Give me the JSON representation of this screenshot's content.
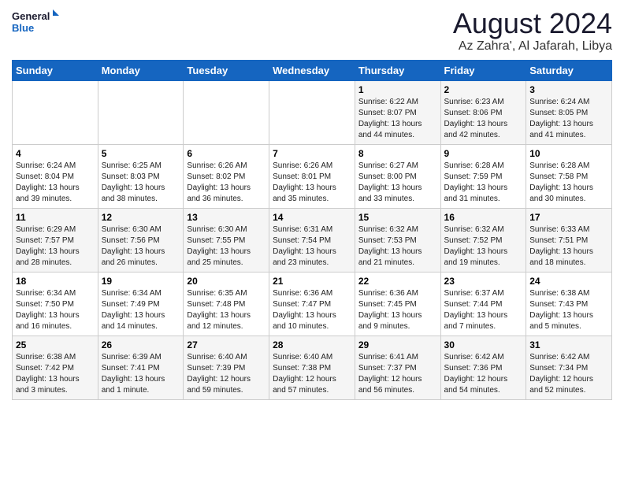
{
  "logo": {
    "line1": "General",
    "line2": "Blue"
  },
  "title": "August 2024",
  "subtitle": "Az Zahra', Al Jafarah, Libya",
  "days_of_week": [
    "Sunday",
    "Monday",
    "Tuesday",
    "Wednesday",
    "Thursday",
    "Friday",
    "Saturday"
  ],
  "weeks": [
    [
      {
        "day": "",
        "info": ""
      },
      {
        "day": "",
        "info": ""
      },
      {
        "day": "",
        "info": ""
      },
      {
        "day": "",
        "info": ""
      },
      {
        "day": "1",
        "info": "Sunrise: 6:22 AM\nSunset: 8:07 PM\nDaylight: 13 hours\nand 44 minutes."
      },
      {
        "day": "2",
        "info": "Sunrise: 6:23 AM\nSunset: 8:06 PM\nDaylight: 13 hours\nand 42 minutes."
      },
      {
        "day": "3",
        "info": "Sunrise: 6:24 AM\nSunset: 8:05 PM\nDaylight: 13 hours\nand 41 minutes."
      }
    ],
    [
      {
        "day": "4",
        "info": "Sunrise: 6:24 AM\nSunset: 8:04 PM\nDaylight: 13 hours\nand 39 minutes."
      },
      {
        "day": "5",
        "info": "Sunrise: 6:25 AM\nSunset: 8:03 PM\nDaylight: 13 hours\nand 38 minutes."
      },
      {
        "day": "6",
        "info": "Sunrise: 6:26 AM\nSunset: 8:02 PM\nDaylight: 13 hours\nand 36 minutes."
      },
      {
        "day": "7",
        "info": "Sunrise: 6:26 AM\nSunset: 8:01 PM\nDaylight: 13 hours\nand 35 minutes."
      },
      {
        "day": "8",
        "info": "Sunrise: 6:27 AM\nSunset: 8:00 PM\nDaylight: 13 hours\nand 33 minutes."
      },
      {
        "day": "9",
        "info": "Sunrise: 6:28 AM\nSunset: 7:59 PM\nDaylight: 13 hours\nand 31 minutes."
      },
      {
        "day": "10",
        "info": "Sunrise: 6:28 AM\nSunset: 7:58 PM\nDaylight: 13 hours\nand 30 minutes."
      }
    ],
    [
      {
        "day": "11",
        "info": "Sunrise: 6:29 AM\nSunset: 7:57 PM\nDaylight: 13 hours\nand 28 minutes."
      },
      {
        "day": "12",
        "info": "Sunrise: 6:30 AM\nSunset: 7:56 PM\nDaylight: 13 hours\nand 26 minutes."
      },
      {
        "day": "13",
        "info": "Sunrise: 6:30 AM\nSunset: 7:55 PM\nDaylight: 13 hours\nand 25 minutes."
      },
      {
        "day": "14",
        "info": "Sunrise: 6:31 AM\nSunset: 7:54 PM\nDaylight: 13 hours\nand 23 minutes."
      },
      {
        "day": "15",
        "info": "Sunrise: 6:32 AM\nSunset: 7:53 PM\nDaylight: 13 hours\nand 21 minutes."
      },
      {
        "day": "16",
        "info": "Sunrise: 6:32 AM\nSunset: 7:52 PM\nDaylight: 13 hours\nand 19 minutes."
      },
      {
        "day": "17",
        "info": "Sunrise: 6:33 AM\nSunset: 7:51 PM\nDaylight: 13 hours\nand 18 minutes."
      }
    ],
    [
      {
        "day": "18",
        "info": "Sunrise: 6:34 AM\nSunset: 7:50 PM\nDaylight: 13 hours\nand 16 minutes."
      },
      {
        "day": "19",
        "info": "Sunrise: 6:34 AM\nSunset: 7:49 PM\nDaylight: 13 hours\nand 14 minutes."
      },
      {
        "day": "20",
        "info": "Sunrise: 6:35 AM\nSunset: 7:48 PM\nDaylight: 13 hours\nand 12 minutes."
      },
      {
        "day": "21",
        "info": "Sunrise: 6:36 AM\nSunset: 7:47 PM\nDaylight: 13 hours\nand 10 minutes."
      },
      {
        "day": "22",
        "info": "Sunrise: 6:36 AM\nSunset: 7:45 PM\nDaylight: 13 hours\nand 9 minutes."
      },
      {
        "day": "23",
        "info": "Sunrise: 6:37 AM\nSunset: 7:44 PM\nDaylight: 13 hours\nand 7 minutes."
      },
      {
        "day": "24",
        "info": "Sunrise: 6:38 AM\nSunset: 7:43 PM\nDaylight: 13 hours\nand 5 minutes."
      }
    ],
    [
      {
        "day": "25",
        "info": "Sunrise: 6:38 AM\nSunset: 7:42 PM\nDaylight: 13 hours\nand 3 minutes."
      },
      {
        "day": "26",
        "info": "Sunrise: 6:39 AM\nSunset: 7:41 PM\nDaylight: 13 hours\nand 1 minute."
      },
      {
        "day": "27",
        "info": "Sunrise: 6:40 AM\nSunset: 7:39 PM\nDaylight: 12 hours\nand 59 minutes."
      },
      {
        "day": "28",
        "info": "Sunrise: 6:40 AM\nSunset: 7:38 PM\nDaylight: 12 hours\nand 57 minutes."
      },
      {
        "day": "29",
        "info": "Sunrise: 6:41 AM\nSunset: 7:37 PM\nDaylight: 12 hours\nand 56 minutes."
      },
      {
        "day": "30",
        "info": "Sunrise: 6:42 AM\nSunset: 7:36 PM\nDaylight: 12 hours\nand 54 minutes."
      },
      {
        "day": "31",
        "info": "Sunrise: 6:42 AM\nSunset: 7:34 PM\nDaylight: 12 hours\nand 52 minutes."
      }
    ]
  ]
}
